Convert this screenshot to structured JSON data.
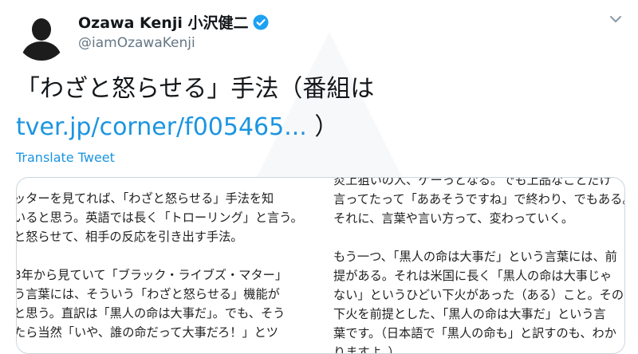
{
  "author": {
    "display_name": "Ozawa Kenji 小沢健二",
    "handle": "@iamOzawaKenji",
    "verified": true
  },
  "tweet": {
    "text_line1": "「わざと怒らせる」手法（番組は",
    "link": "tver.jp/corner/f005465...",
    "text_after_link": " ）",
    "translate_label": "Translate Tweet"
  },
  "media": {
    "left_lines": [
      "ッターを見てれば、「わざと怒らせる」手法を知",
      "いると思う。英語では長く「トローリング」と言う。",
      "と怒らせて、相手の反応を引き出す手法。",
      "",
      "3年から見ていて「ブラック・ライブズ・マター」",
      "う言葉には、そういう「わざと怒らせる」機能が",
      "と思う。直訳は「黒人の命は大事だ」。でも、そう",
      "たら当然「いや、誰の命だって大事だろ！」とツ"
    ],
    "right_lines": [
      "炎上狙いの人、ゲーっとなる。でも上品なことだけ",
      "言ってたって「ああそうですね」で終わり、でもある。",
      "それに、言葉や言い方って、変わっていく。",
      "",
      "もう一つ、「黒人の命は大事だ」という言葉には、前",
      "提がある。それは米国に長く「黒人の命は大事じゃ",
      "ない」というひどい下火があった（ある）こと。その",
      "下火を前提とした、「黒人の命は大事だ」という言",
      "葉です。（日本語で「黒人の命も」と訳すのも、わか",
      "りますよ。）"
    ]
  },
  "icons": {
    "avatar": "avatar-silhouette",
    "verified": "verified-badge-icon",
    "menu": "chevron-down-icon"
  },
  "colors": {
    "link": "#1b95e0",
    "verified": "#1da1f2",
    "secondary_text": "#657786"
  }
}
